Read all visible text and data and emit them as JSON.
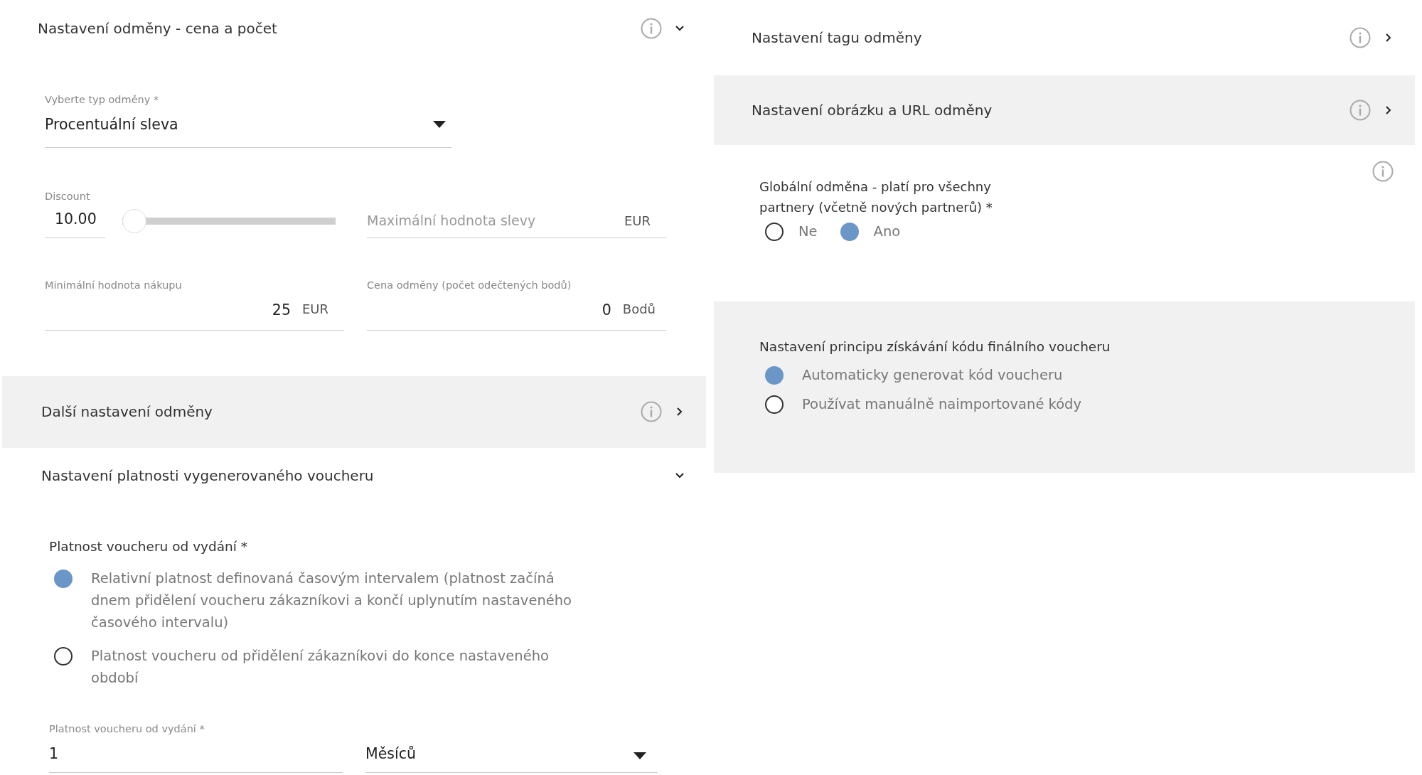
{
  "reward_price_section": {
    "title": "Nastavení odměny - cena a počet",
    "expanded": true,
    "reward_type_select": {
      "label": "Vyberte typ odměny *",
      "value": "Procentuální sleva"
    },
    "discount": {
      "label": "Discount",
      "value": "10.00",
      "level": 0
    },
    "max_discount": {
      "placeholder": "Maximální hodnota slevy",
      "unit": "EUR"
    },
    "min_purchase": {
      "label": "Minimální hodnota nákupu",
      "value": "25",
      "unit": "EUR"
    },
    "reward_cost": {
      "label": "Cena odměny (počet odečtených bodů)",
      "value": "0",
      "unit": "Bodů"
    }
  },
  "more_settings_section": {
    "title": "Další nastavení odměny",
    "expanded": false
  },
  "validity_section": {
    "title": "Nastavení platnosti vygenerovaného voucheru",
    "expanded": true,
    "group_label": "Platnost voucheru od vydání *",
    "options": [
      {
        "label": "Relativní platnost definovaná časovým intervalem (platnost začíná dnem přidělení voucheru zákazníkovi a končí uplynutím nastaveného časového intervalu)",
        "selected": true
      },
      {
        "label": "Platnost voucheru od přidělení zákazníkovi do konce nastaveného období",
        "selected": false
      }
    ],
    "period": {
      "label": "Platnost voucheru od vydání  *",
      "value": "1"
    },
    "period_unit": {
      "value": "Měsíců"
    }
  },
  "tag_section": {
    "title": "Nastavení tagu odměny",
    "expanded": false
  },
  "image_url_section": {
    "title": "Nastavení obrázku a URL odměny",
    "expanded": false
  },
  "global_reward": {
    "label": "Globální odměna - platí pro všechny partnery (včetně nových partnerů) *",
    "options": [
      {
        "label": "Ne",
        "selected": false
      },
      {
        "label": "Ano",
        "selected": true
      }
    ]
  },
  "code_principle": {
    "label": "Nastavení principu získávání kódu finálního voucheru",
    "options": [
      {
        "label": "Automaticky generovat kód voucheru",
        "selected": true
      },
      {
        "label": "Používat manuálně naimportované kódy",
        "selected": false
      }
    ]
  }
}
